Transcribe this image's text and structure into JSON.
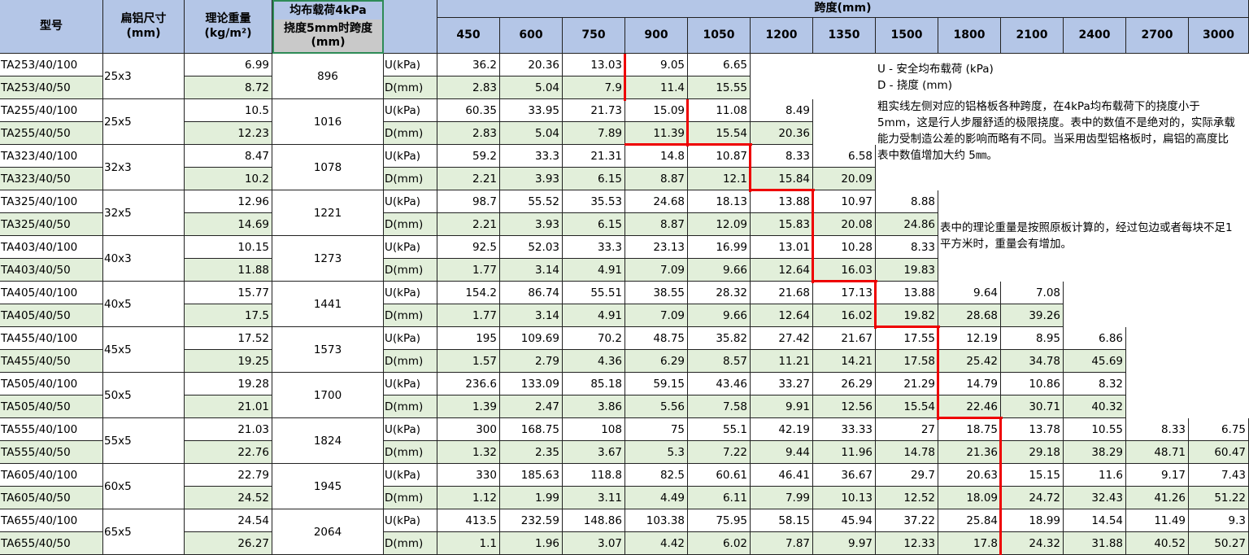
{
  "headers": {
    "model": "型号",
    "size": "扁铝尺寸\n(mm)",
    "weight": "理论重量\n(kg/m²)",
    "load_line1": "均布载荷4kPa",
    "load_line2": "挠度5mm时跨度\n(mm)",
    "span": "跨度(mm)",
    "spans": [
      "450",
      "600",
      "750",
      "900",
      "1050",
      "1200",
      "1350",
      "1500",
      "1800",
      "2100",
      "2400",
      "2700",
      "3000"
    ]
  },
  "groups": [
    {
      "size": "25x3",
      "span5": "896",
      "rows": [
        {
          "model": "TA253/40/100",
          "weight": "6.99",
          "type": "U(kPa)",
          "vals": [
            "36.2",
            "20.36",
            "13.03",
            "9.05",
            "6.65",
            "",
            "",
            "",
            "",
            "",
            "",
            "",
            ""
          ]
        },
        {
          "model": "TA253/40/50",
          "weight": "8.72",
          "type": "D(mm)",
          "vals": [
            "2.83",
            "5.04",
            "7.9",
            "11.4",
            "15.55",
            "",
            "",
            "",
            "",
            "",
            "",
            "",
            ""
          ]
        }
      ]
    },
    {
      "size": "25x5",
      "span5": "1016",
      "rows": [
        {
          "model": "TA255/40/100",
          "weight": "10.5",
          "type": "U(kPa)",
          "vals": [
            "60.35",
            "33.95",
            "21.73",
            "15.09",
            "11.08",
            "8.49",
            "",
            "",
            "",
            "",
            "",
            "",
            ""
          ]
        },
        {
          "model": "TA255/40/50",
          "weight": "12.23",
          "type": "D(mm)",
          "vals": [
            "2.83",
            "5.04",
            "7.89",
            "11.39",
            "15.54",
            "20.36",
            "",
            "",
            "",
            "",
            "",
            "",
            ""
          ]
        }
      ]
    },
    {
      "size": "32x3",
      "span5": "1078",
      "rows": [
        {
          "model": "TA323/40/100",
          "weight": "8.47",
          "type": "U(kPa)",
          "vals": [
            "59.2",
            "33.3",
            "21.31",
            "14.8",
            "10.87",
            "8.33",
            "6.58",
            "",
            "",
            "",
            "",
            "",
            ""
          ]
        },
        {
          "model": "TA323/40/50",
          "weight": "10.2",
          "type": "D(mm)",
          "vals": [
            "2.21",
            "3.93",
            "6.15",
            "8.87",
            "12.1",
            "15.84",
            "20.09",
            "",
            "",
            "",
            "",
            "",
            ""
          ]
        }
      ]
    },
    {
      "size": "32x5",
      "span5": "1221",
      "rows": [
        {
          "model": "TA325/40/100",
          "weight": "12.96",
          "type": "U(kPa)",
          "vals": [
            "98.7",
            "55.52",
            "35.53",
            "24.68",
            "18.13",
            "13.88",
            "10.97",
            "8.88",
            "",
            "",
            "",
            "",
            ""
          ]
        },
        {
          "model": "TA325/40/50",
          "weight": "14.69",
          "type": "D(mm)",
          "vals": [
            "2.21",
            "3.93",
            "6.15",
            "8.87",
            "12.09",
            "15.83",
            "20.08",
            "24.86",
            "",
            "",
            "",
            "",
            ""
          ]
        }
      ]
    },
    {
      "size": "40x3",
      "span5": "1273",
      "rows": [
        {
          "model": "TA403/40/100",
          "weight": "10.15",
          "type": "U(kPa)",
          "vals": [
            "92.5",
            "52.03",
            "33.3",
            "23.13",
            "16.99",
            "13.01",
            "10.28",
            "8.33",
            "",
            "",
            "",
            "",
            ""
          ]
        },
        {
          "model": "TA403/40/50",
          "weight": "11.88",
          "type": "D(mm)",
          "vals": [
            "1.77",
            "3.14",
            "4.91",
            "7.09",
            "9.66",
            "12.64",
            "16.03",
            "19.83",
            "",
            "",
            "",
            "",
            ""
          ]
        }
      ]
    },
    {
      "size": "40x5",
      "span5": "1441",
      "rows": [
        {
          "model": "TA405/40/100",
          "weight": "15.77",
          "type": "U(kPa)",
          "vals": [
            "154.2",
            "86.74",
            "55.51",
            "38.55",
            "28.32",
            "21.68",
            "17.13",
            "13.88",
            "9.64",
            "7.08",
            "",
            "",
            ""
          ]
        },
        {
          "model": "TA405/40/50",
          "weight": "17.5",
          "type": "D(mm)",
          "vals": [
            "1.77",
            "3.14",
            "4.91",
            "7.09",
            "9.66",
            "12.64",
            "16.02",
            "19.82",
            "28.68",
            "39.26",
            "",
            "",
            ""
          ]
        }
      ]
    },
    {
      "size": "45x5",
      "span5": "1573",
      "rows": [
        {
          "model": "TA455/40/100",
          "weight": "17.52",
          "type": "U(kPa)",
          "vals": [
            "195",
            "109.69",
            "70.2",
            "48.75",
            "35.82",
            "27.42",
            "21.67",
            "17.55",
            "12.19",
            "8.95",
            "6.86",
            "",
            ""
          ]
        },
        {
          "model": "TA455/40/50",
          "weight": "19.25",
          "type": "D(mm)",
          "vals": [
            "1.57",
            "2.79",
            "4.36",
            "6.29",
            "8.57",
            "11.21",
            "14.21",
            "17.58",
            "25.42",
            "34.78",
            "45.69",
            "",
            ""
          ]
        }
      ]
    },
    {
      "size": "50x5",
      "span5": "1700",
      "rows": [
        {
          "model": "TA505/40/100",
          "weight": "19.28",
          "type": "U(kPa)",
          "vals": [
            "236.6",
            "133.09",
            "85.18",
            "59.15",
            "43.46",
            "33.27",
            "26.29",
            "21.29",
            "14.79",
            "10.86",
            "8.32",
            "",
            ""
          ]
        },
        {
          "model": "TA505/40/50",
          "weight": "21.01",
          "type": "D(mm)",
          "vals": [
            "1.39",
            "2.47",
            "3.86",
            "5.56",
            "7.58",
            "9.91",
            "12.56",
            "15.54",
            "22.46",
            "30.71",
            "40.32",
            "",
            ""
          ]
        }
      ]
    },
    {
      "size": "55x5",
      "span5": "1824",
      "rows": [
        {
          "model": "TA555/40/100",
          "weight": "21.03",
          "type": "U(kPa)",
          "vals": [
            "300",
            "168.75",
            "108",
            "75",
            "55.1",
            "42.19",
            "33.33",
            "27",
            "18.75",
            "13.78",
            "10.55",
            "8.33",
            "6.75"
          ]
        },
        {
          "model": "TA555/40/50",
          "weight": "22.76",
          "type": "D(mm)",
          "vals": [
            "1.32",
            "2.35",
            "3.67",
            "5.3",
            "7.22",
            "9.44",
            "11.96",
            "14.78",
            "21.36",
            "29.18",
            "38.29",
            "48.71",
            "60.47"
          ]
        }
      ]
    },
    {
      "size": "60x5",
      "span5": "1945",
      "rows": [
        {
          "model": "TA605/40/100",
          "weight": "22.79",
          "type": "U(kPa)",
          "vals": [
            "330",
            "185.63",
            "118.8",
            "82.5",
            "60.61",
            "46.41",
            "36.67",
            "29.7",
            "20.63",
            "15.15",
            "11.6",
            "9.17",
            "7.43"
          ]
        },
        {
          "model": "TA605/40/50",
          "weight": "24.52",
          "type": "D(mm)",
          "vals": [
            "1.12",
            "1.99",
            "3.11",
            "4.49",
            "6.11",
            "7.99",
            "10.13",
            "12.52",
            "18.09",
            "24.72",
            "32.43",
            "41.26",
            "51.22"
          ]
        }
      ]
    },
    {
      "size": "65x5",
      "span5": "2064",
      "rows": [
        {
          "model": "TA655/40/100",
          "weight": "24.54",
          "type": "U(kPa)",
          "vals": [
            "413.5",
            "232.59",
            "148.86",
            "103.38",
            "75.95",
            "58.15",
            "45.94",
            "37.22",
            "25.84",
            "18.99",
            "14.54",
            "11.49",
            "9.3"
          ]
        },
        {
          "model": "TA655/40/50",
          "weight": "26.27",
          "type": "D(mm)",
          "vals": [
            "1.1",
            "1.96",
            "3.07",
            "4.42",
            "6.02",
            "7.87",
            "9.97",
            "12.33",
            "17.8",
            "24.32",
            "31.88",
            "40.52",
            "50.27"
          ]
        }
      ]
    }
  ],
  "notes": {
    "legend_u": "U - 安全均布载荷 (kPa)",
    "legend_d": "D - 挠度 (mm)",
    "para1": "粗实线左侧对应的铝格板各种跨度，在4kPa均布载荷下的挠度小于5mm，这是行人步履舒适的极限挠度。表中的数值不是绝对的，实际承载能力受制造公差的影响而略有不同。当采用齿型铝格板时，扁铝的高度比表中数值增加大约 5㎜。",
    "para2": "表中的理论重量是按照原板计算的，经过包边或者每块不足1平方米时，重量会有增加。"
  },
  "colors": {
    "header": "#b4c6e7",
    "green_row": "#e2efda",
    "red_line": "#ee0000"
  }
}
